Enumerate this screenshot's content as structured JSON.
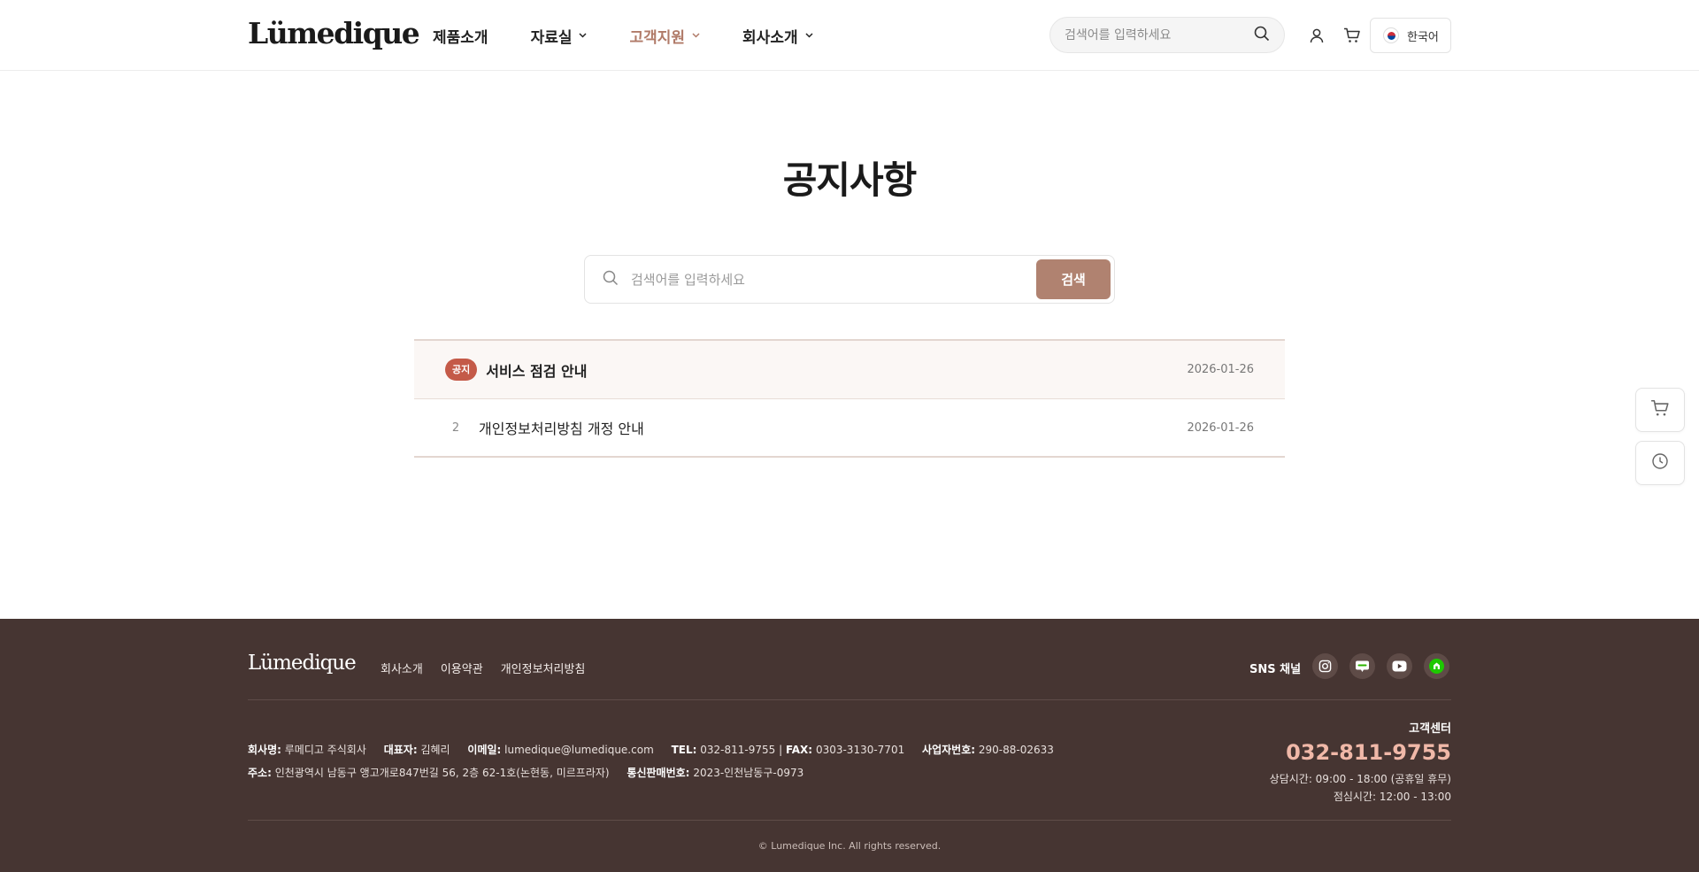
{
  "header": {
    "logo": "Lümedique",
    "nav": [
      {
        "label": "제품소개",
        "dropdown": false
      },
      {
        "label": "자료실",
        "dropdown": true
      },
      {
        "label": "고객지원",
        "dropdown": true,
        "active": true
      },
      {
        "label": "회사소개",
        "dropdown": true
      }
    ],
    "search_placeholder": "검색어를 입력하세요",
    "language": "한국어"
  },
  "main": {
    "title": "공지사항",
    "search_placeholder": "검색어를 입력하세요",
    "search_button": "검색",
    "posts": [
      {
        "badge": "공지",
        "title": "서비스 점검 안내",
        "date": "2026-01-26"
      },
      {
        "number": "2",
        "title": "개인정보처리방침 개정 안내",
        "date": "2026-01-26"
      }
    ]
  },
  "footer": {
    "logo": "Lümedique",
    "links": [
      "회사소개",
      "이용약관",
      "개인정보처리방침"
    ],
    "sns_label": "SNS 채널",
    "company": {
      "company_label": "회사명:",
      "company_value": "루메디고 주식회사",
      "ceo_label": "대표자:",
      "ceo_value": "김혜리",
      "email_label": "이메일:",
      "email_value": "lumedique@lumedique.com",
      "tel_label": "TEL:",
      "tel_value": "032-811-9755",
      "fax_label": "FAX:",
      "fax_value": "0303-3130-7701",
      "bizno_label": "사업자번호:",
      "bizno_value": "290-88-02633",
      "address_label": "주소:",
      "address_value": "인천광역시 남동구 앵고개로847번길 56, 2층 62-1호(논현동, 미르프라자)",
      "ecommerce_label": "통신판매번호:",
      "ecommerce_value": "2023-인천남동구-0973"
    },
    "customer_center": {
      "label": "고객센터",
      "phone": "032-811-9755",
      "hours": "상담시간: 09:00 - 18:00 (공휴일 휴무)",
      "lunch": "점심시간: 12:00 - 13:00"
    },
    "copyright": "© Lumedique Inc. All rights reserved."
  },
  "colors": {
    "accent": "#b08270",
    "nav_active": "#b07a68",
    "badge": "#c45a48",
    "footer_bg": "#463532",
    "footer_phone": "#f0b8a8"
  }
}
